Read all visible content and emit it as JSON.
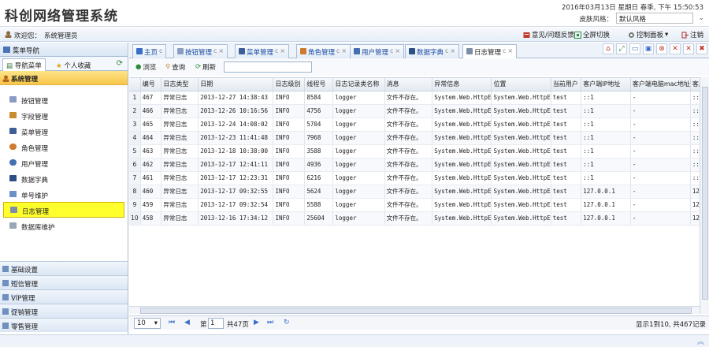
{
  "header": {
    "title": "科创网络管理系统",
    "datetime": "2016年03月13日 星期日 春季, 下午 15:50:53",
    "skin_label": "皮肤风格：",
    "skin_value": "默认风格"
  },
  "userbar": {
    "welcome": "欢迎您：",
    "user": "系统管理员",
    "feedback": "意见/问题反馈",
    "fullscreen": "全屏切换",
    "control": "控制面板",
    "logout": "注销"
  },
  "sidebar": {
    "title": "菜单导航",
    "tabs": [
      "导航菜单",
      "个人收藏"
    ],
    "section": "系统管理",
    "items": [
      "按钮管理",
      "字段管理",
      "菜单管理",
      "角色管理",
      "用户管理",
      "数据字典",
      "单号维护",
      "日志管理",
      "数据库维护"
    ],
    "groups": [
      "基础设置",
      "短信管理",
      "VIP管理",
      "促销管理",
      "零售管理"
    ]
  },
  "tabs": [
    "主页",
    "按钮管理",
    "菜单管理",
    "角色管理",
    "用户管理",
    "数据字典",
    "日志管理"
  ],
  "toolbar": {
    "browse": "浏览",
    "query": "查询",
    "refresh": "刷新"
  },
  "grid": {
    "columns": [
      "编号",
      "日志类型",
      "日期",
      "日志级别",
      "线程号",
      "日志记录类名称",
      "消息",
      "异常信息",
      "位置",
      "当前用户",
      "客户端IP地址",
      "客户端电脑mac地址",
      "客户"
    ],
    "rows": [
      [
        "1",
        "467",
        "异常日志",
        "2013-12-27 14:38:43",
        "INFO",
        "8584",
        "logger",
        "文件不存在。",
        "System.Web.HttpE",
        "System.Web.HttpE",
        "test",
        "::1",
        "-",
        "::1"
      ],
      [
        "2",
        "466",
        "异常日志",
        "2013-12-26 10:16:56",
        "INFO",
        "4756",
        "logger",
        "文件不存在。",
        "System.Web.HttpE",
        "System.Web.HttpE",
        "test",
        "::1",
        "-",
        "::1"
      ],
      [
        "3",
        "465",
        "异常日志",
        "2013-12-24 14:08:02",
        "INFO",
        "5704",
        "logger",
        "文件不存在。",
        "System.Web.HttpE",
        "System.Web.HttpE",
        "test",
        "::1",
        "-",
        "::1"
      ],
      [
        "4",
        "464",
        "异常日志",
        "2013-12-23 11:41:48",
        "INFO",
        "7968",
        "logger",
        "文件不存在。",
        "System.Web.HttpE",
        "System.Web.HttpE",
        "test",
        "::1",
        "-",
        "::1"
      ],
      [
        "5",
        "463",
        "异常日志",
        "2013-12-18 10:38:00",
        "INFO",
        "3588",
        "logger",
        "文件不存在。",
        "System.Web.HttpE",
        "System.Web.HttpE",
        "test",
        "::1",
        "-",
        "::1"
      ],
      [
        "6",
        "462",
        "异常日志",
        "2013-12-17 12:41:11",
        "INFO",
        "4936",
        "logger",
        "文件不存在。",
        "System.Web.HttpE",
        "System.Web.HttpE",
        "test",
        "::1",
        "-",
        "::1"
      ],
      [
        "7",
        "461",
        "异常日志",
        "2013-12-17 12:23:31",
        "INFO",
        "6216",
        "logger",
        "文件不存在。",
        "System.Web.HttpE",
        "System.Web.HttpE",
        "test",
        "::1",
        "-",
        "::1"
      ],
      [
        "8",
        "460",
        "异常日志",
        "2013-12-17 09:32:55",
        "INFO",
        "5624",
        "logger",
        "文件不存在。",
        "System.Web.HttpE",
        "System.Web.HttpE",
        "test",
        "127.0.0.1",
        "-",
        "127"
      ],
      [
        "9",
        "459",
        "异常日志",
        "2013-12-17 09:32:54",
        "INFO",
        "5588",
        "logger",
        "文件不存在。",
        "System.Web.HttpE",
        "System.Web.HttpE",
        "test",
        "127.0.0.1",
        "-",
        "127"
      ],
      [
        "10",
        "458",
        "异常日志",
        "2013-12-16 17:34:12",
        "INFO",
        "25604",
        "logger",
        "文件不存在。",
        "System.Web.HttpE",
        "System.Web.HttpE",
        "test",
        "127.0.0.1",
        "-",
        "127"
      ]
    ]
  },
  "pager": {
    "page_size": "10",
    "page_prefix": "第",
    "page_value": "1",
    "page_total": "共47页",
    "summary": "显示1到10, 共467记录"
  },
  "colors": {
    "accent": "#f8c64a",
    "selected": "#ffff2e",
    "link": "#1b4aa0"
  }
}
